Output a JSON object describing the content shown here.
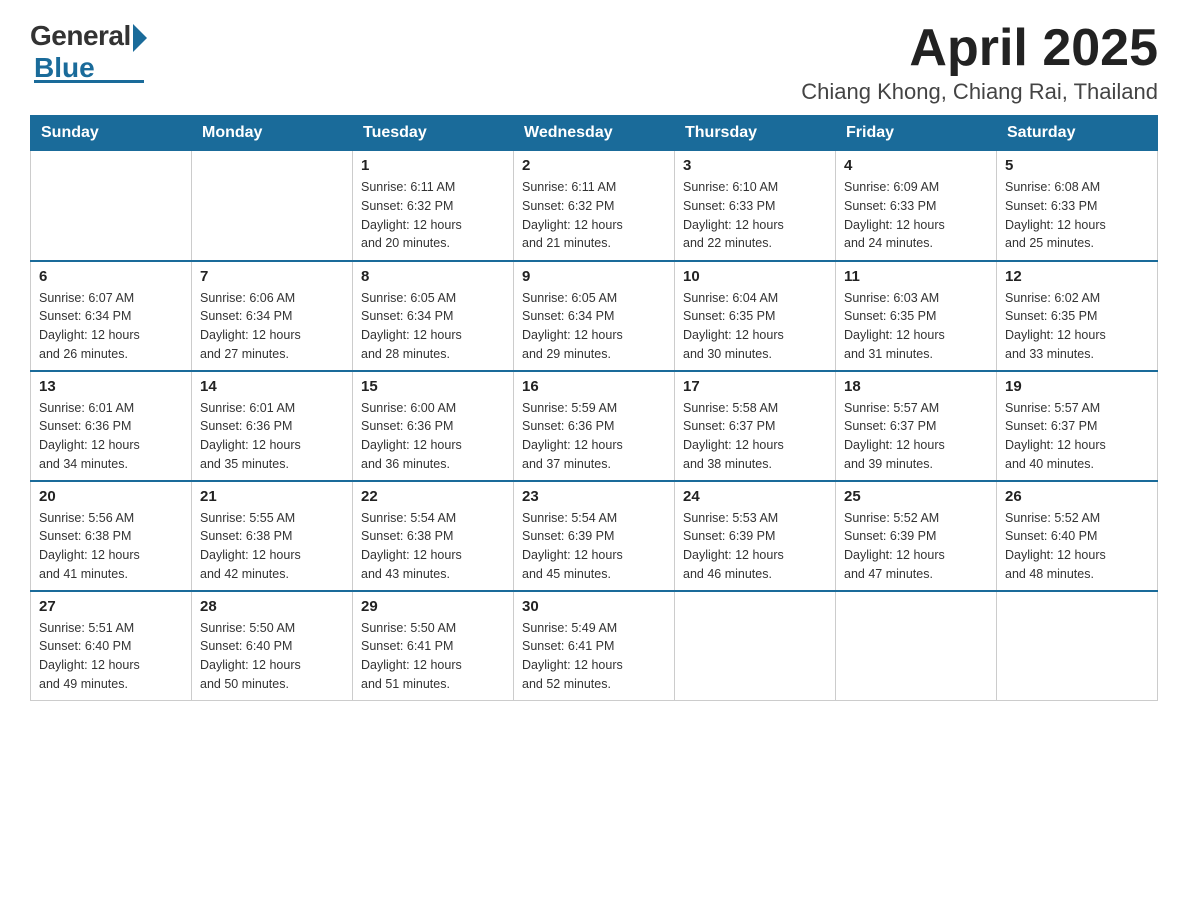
{
  "logo": {
    "general": "General",
    "blue": "Blue"
  },
  "title": {
    "month_year": "April 2025",
    "location": "Chiang Khong, Chiang Rai, Thailand"
  },
  "days_of_week": [
    "Sunday",
    "Monday",
    "Tuesday",
    "Wednesday",
    "Thursday",
    "Friday",
    "Saturday"
  ],
  "weeks": [
    [
      {
        "day": "",
        "info": ""
      },
      {
        "day": "",
        "info": ""
      },
      {
        "day": "1",
        "info": "Sunrise: 6:11 AM\nSunset: 6:32 PM\nDaylight: 12 hours\nand 20 minutes."
      },
      {
        "day": "2",
        "info": "Sunrise: 6:11 AM\nSunset: 6:32 PM\nDaylight: 12 hours\nand 21 minutes."
      },
      {
        "day": "3",
        "info": "Sunrise: 6:10 AM\nSunset: 6:33 PM\nDaylight: 12 hours\nand 22 minutes."
      },
      {
        "day": "4",
        "info": "Sunrise: 6:09 AM\nSunset: 6:33 PM\nDaylight: 12 hours\nand 24 minutes."
      },
      {
        "day": "5",
        "info": "Sunrise: 6:08 AM\nSunset: 6:33 PM\nDaylight: 12 hours\nand 25 minutes."
      }
    ],
    [
      {
        "day": "6",
        "info": "Sunrise: 6:07 AM\nSunset: 6:34 PM\nDaylight: 12 hours\nand 26 minutes."
      },
      {
        "day": "7",
        "info": "Sunrise: 6:06 AM\nSunset: 6:34 PM\nDaylight: 12 hours\nand 27 minutes."
      },
      {
        "day": "8",
        "info": "Sunrise: 6:05 AM\nSunset: 6:34 PM\nDaylight: 12 hours\nand 28 minutes."
      },
      {
        "day": "9",
        "info": "Sunrise: 6:05 AM\nSunset: 6:34 PM\nDaylight: 12 hours\nand 29 minutes."
      },
      {
        "day": "10",
        "info": "Sunrise: 6:04 AM\nSunset: 6:35 PM\nDaylight: 12 hours\nand 30 minutes."
      },
      {
        "day": "11",
        "info": "Sunrise: 6:03 AM\nSunset: 6:35 PM\nDaylight: 12 hours\nand 31 minutes."
      },
      {
        "day": "12",
        "info": "Sunrise: 6:02 AM\nSunset: 6:35 PM\nDaylight: 12 hours\nand 33 minutes."
      }
    ],
    [
      {
        "day": "13",
        "info": "Sunrise: 6:01 AM\nSunset: 6:36 PM\nDaylight: 12 hours\nand 34 minutes."
      },
      {
        "day": "14",
        "info": "Sunrise: 6:01 AM\nSunset: 6:36 PM\nDaylight: 12 hours\nand 35 minutes."
      },
      {
        "day": "15",
        "info": "Sunrise: 6:00 AM\nSunset: 6:36 PM\nDaylight: 12 hours\nand 36 minutes."
      },
      {
        "day": "16",
        "info": "Sunrise: 5:59 AM\nSunset: 6:36 PM\nDaylight: 12 hours\nand 37 minutes."
      },
      {
        "day": "17",
        "info": "Sunrise: 5:58 AM\nSunset: 6:37 PM\nDaylight: 12 hours\nand 38 minutes."
      },
      {
        "day": "18",
        "info": "Sunrise: 5:57 AM\nSunset: 6:37 PM\nDaylight: 12 hours\nand 39 minutes."
      },
      {
        "day": "19",
        "info": "Sunrise: 5:57 AM\nSunset: 6:37 PM\nDaylight: 12 hours\nand 40 minutes."
      }
    ],
    [
      {
        "day": "20",
        "info": "Sunrise: 5:56 AM\nSunset: 6:38 PM\nDaylight: 12 hours\nand 41 minutes."
      },
      {
        "day": "21",
        "info": "Sunrise: 5:55 AM\nSunset: 6:38 PM\nDaylight: 12 hours\nand 42 minutes."
      },
      {
        "day": "22",
        "info": "Sunrise: 5:54 AM\nSunset: 6:38 PM\nDaylight: 12 hours\nand 43 minutes."
      },
      {
        "day": "23",
        "info": "Sunrise: 5:54 AM\nSunset: 6:39 PM\nDaylight: 12 hours\nand 45 minutes."
      },
      {
        "day": "24",
        "info": "Sunrise: 5:53 AM\nSunset: 6:39 PM\nDaylight: 12 hours\nand 46 minutes."
      },
      {
        "day": "25",
        "info": "Sunrise: 5:52 AM\nSunset: 6:39 PM\nDaylight: 12 hours\nand 47 minutes."
      },
      {
        "day": "26",
        "info": "Sunrise: 5:52 AM\nSunset: 6:40 PM\nDaylight: 12 hours\nand 48 minutes."
      }
    ],
    [
      {
        "day": "27",
        "info": "Sunrise: 5:51 AM\nSunset: 6:40 PM\nDaylight: 12 hours\nand 49 minutes."
      },
      {
        "day": "28",
        "info": "Sunrise: 5:50 AM\nSunset: 6:40 PM\nDaylight: 12 hours\nand 50 minutes."
      },
      {
        "day": "29",
        "info": "Sunrise: 5:50 AM\nSunset: 6:41 PM\nDaylight: 12 hours\nand 51 minutes."
      },
      {
        "day": "30",
        "info": "Sunrise: 5:49 AM\nSunset: 6:41 PM\nDaylight: 12 hours\nand 52 minutes."
      },
      {
        "day": "",
        "info": ""
      },
      {
        "day": "",
        "info": ""
      },
      {
        "day": "",
        "info": ""
      }
    ]
  ]
}
